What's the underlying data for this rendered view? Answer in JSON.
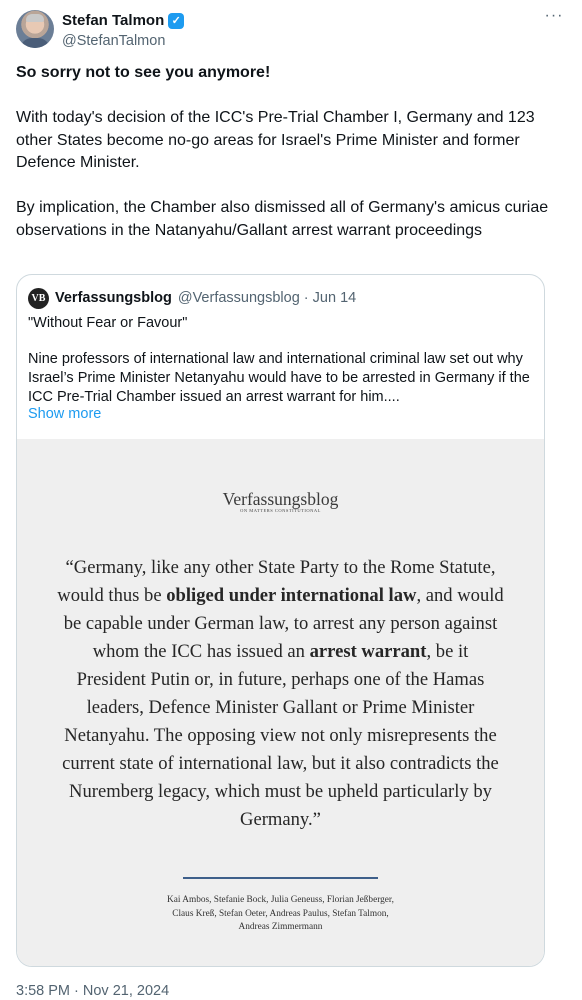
{
  "author": {
    "display_name": "Stefan Talmon",
    "verified_mark": "✓",
    "handle": "@StefanTalmon",
    "avatar_icon": "profile-photo",
    "more_icon": "···"
  },
  "tweet": {
    "lead": "So sorry not to see you anymore!",
    "paragraph1": "With today's decision of the ICC's Pre-Trial Chamber I, Germany and 123 other States become no-go areas for Israel's Prime Minister and former Defence Minister.",
    "paragraph2": "By implication, the Chamber also dismissed all of Germany's  amicus curiae observations in the Natanyahu/Gallant arrest warrant proceedings",
    "timestamp": "3:58 PM · Nov 21, 2024"
  },
  "quoted_tweet": {
    "avatar_text": "VB",
    "name": "Verfassungsblog",
    "meta": "@Verfassungsblog · Jun 14",
    "title": "\"Without Fear or Favour\"",
    "body": "Nine professors of international law and international criminal law set out why Israel’s Prime Minister Netanyahu would have to be arrested in Germany if the ICC Pre-Trial Chamber issued an arrest warrant for him....",
    "show_more": "Show more",
    "image": {
      "logo": "Verfassungsblog",
      "tagline": "ON MATTERS CONSTITUTIONAL",
      "quote": {
        "part1": "“Germany, like any other State Party to the Rome Statute, would thus be ",
        "bold1": "obliged under international law",
        "part2": ", and would be capable under German law, to arrest any person against whom the ICC has issued an ",
        "bold2": "arrest warrant",
        "part3": ", be it President Putin or, in future, perhaps one of the Hamas leaders, Defence Minister Gallant or Prime Minister Netanyahu. The opposing view not only misrepresents the current state of international law, but it also contradicts the Nuremberg legacy, which must be upheld particularly by Germany.”"
      },
      "authors": "Kai Ambos, Stefanie Bock, Julia Geneuss, Florian Jeßberger, Claus Kreß, Stefan Oeter, Andreas Paulus, Stefan Talmon, Andreas Zimmermann"
    }
  },
  "colors": {
    "link": "#1d9bf0",
    "secondary_text": "#536471",
    "divider": "#3e5f8a",
    "image_bg": "#efefef"
  }
}
